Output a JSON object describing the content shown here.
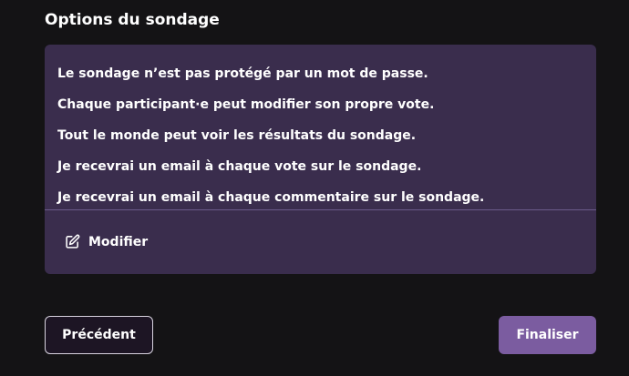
{
  "section": {
    "title": "Options du sondage"
  },
  "options": {
    "items": [
      "Le sondage n’est pas protégé par un mot de passe.",
      "Chaque participant·e peut modifier son propre vote.",
      "Tout le monde peut voir les résultats du sondage.",
      "Je recevrai un email à chaque vote sur le sondage.",
      "Je recevrai un email à chaque commentaire sur le sondage."
    ],
    "edit_label": "Modifier",
    "edit_icon": "pencil-square-icon"
  },
  "navigation": {
    "previous_label": "Précédent",
    "finish_label": "Finaliser"
  },
  "colors": {
    "background": "#141315",
    "card": "#3a2d4d",
    "accent": "#7b5ca0",
    "text": "#ffffff"
  }
}
